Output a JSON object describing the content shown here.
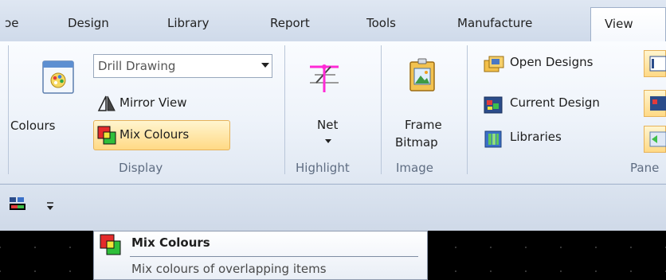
{
  "tabs": [
    {
      "label": "ɔe",
      "active": false
    },
    {
      "label": "Design",
      "active": false
    },
    {
      "label": "Library",
      "active": false
    },
    {
      "label": "Report",
      "active": false
    },
    {
      "label": "Tools",
      "active": false
    },
    {
      "label": "Manufacture",
      "active": false
    },
    {
      "label": "View",
      "active": true
    }
  ],
  "display_group": {
    "colours_label": "Colours",
    "combo_value": "Drill Drawing",
    "mirror_view_label": "Mirror View",
    "mix_colours_label": "Mix Colours",
    "group_label": "Display"
  },
  "highlight_group": {
    "net_label": "Net",
    "group_label": "Highlight"
  },
  "image_group": {
    "frame_label": "Frame",
    "bitmap_label": "Bitmap",
    "group_label": "Image"
  },
  "panes_group": {
    "open_designs_label": "Open Designs",
    "current_design_label": "Current Design",
    "libraries_label": "Libraries",
    "group_label": "Pane"
  },
  "tooltip": {
    "title": "Mix Colours",
    "description": "Mix colours of overlapping items"
  },
  "colors": {
    "highlight_bg": "#ffd985",
    "ribbon_bg": "#eef3fa",
    "canvas_bg": "#000000"
  }
}
